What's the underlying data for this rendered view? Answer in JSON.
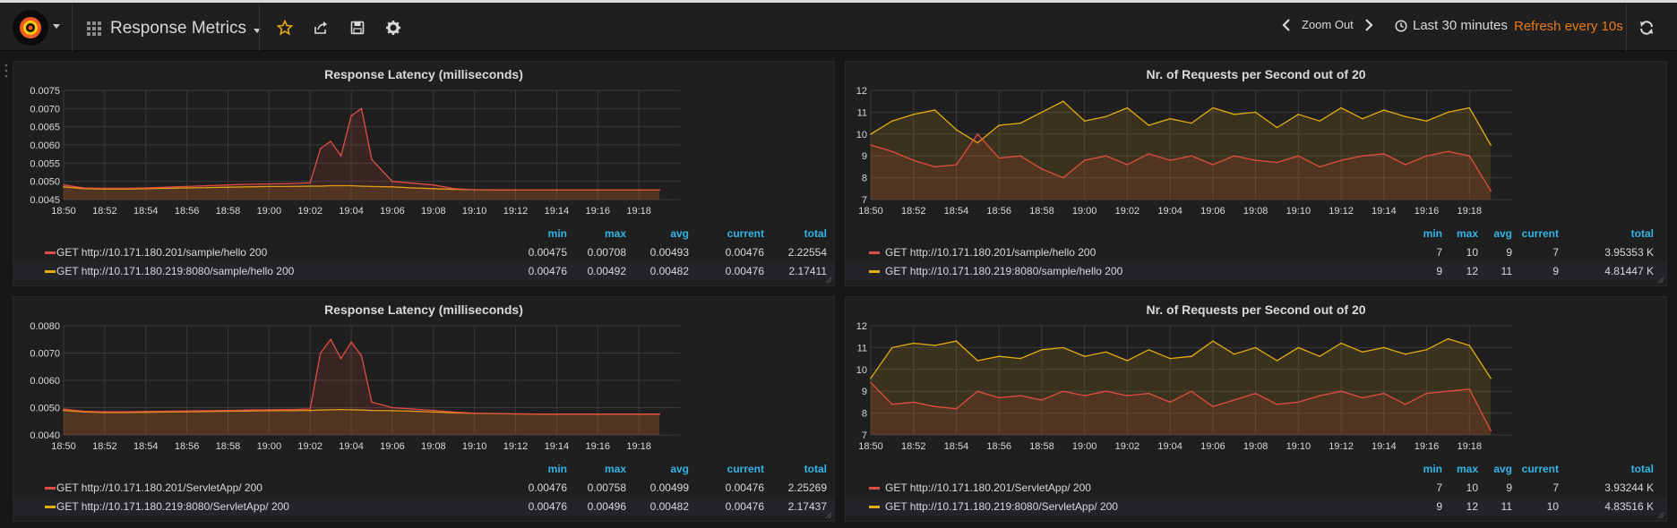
{
  "topbar": {
    "dashboard_title": "Response Metrics",
    "zoom_out_label": "Zoom Out",
    "time_range_label": "Last 30 minutes",
    "refresh_label": "Refresh every 10s"
  },
  "colors": {
    "series_red": "#e24d42",
    "series_yellow": "#e5ac0e",
    "accent_orange": "#eb7b18",
    "legend_header_blue": "#33b5e5"
  },
  "icons": [
    "grafana-logo-icon",
    "dashboard-grid-icon",
    "star-icon",
    "share-icon",
    "save-icon",
    "gear-icon",
    "chevron-left-icon",
    "chevron-right-icon",
    "clock-icon",
    "refresh-icon"
  ],
  "chart_data": [
    {
      "type": "area",
      "title": "Response Latency (milliseconds)",
      "xlabel": "",
      "ylabel": "",
      "x_ticks": [
        "18:50",
        "18:52",
        "18:54",
        "18:56",
        "18:58",
        "19:00",
        "19:02",
        "19:04",
        "19:06",
        "19:08",
        "19:10",
        "19:12",
        "19:14",
        "19:16",
        "19:18"
      ],
      "y_ticks": [
        "0.0045",
        "0.0050",
        "0.0055",
        "0.0060",
        "0.0065",
        "0.0070",
        "0.0075"
      ],
      "ylim": [
        0.0045,
        0.0075
      ],
      "grid": true,
      "x": [
        "18:50",
        "18:51",
        "18:52",
        "18:53",
        "18:54",
        "18:55",
        "18:56",
        "18:57",
        "18:58",
        "18:59",
        "19:00",
        "19:01",
        "19:02",
        "19:02:30",
        "19:03",
        "19:03:30",
        "19:04",
        "19:04:30",
        "19:05",
        "19:06",
        "19:07",
        "19:08",
        "19:09",
        "19:10",
        "19:12",
        "19:14",
        "19:16",
        "19:18",
        "19:19"
      ],
      "series": [
        {
          "name": "GET http://10.171.180.201/sample/hello 200",
          "color": "#e24d42",
          "values": [
            0.0049,
            0.00482,
            0.00481,
            0.00481,
            0.00482,
            0.00484,
            0.00486,
            0.00488,
            0.0049,
            0.00492,
            0.00493,
            0.00494,
            0.00496,
            0.0059,
            0.0061,
            0.0057,
            0.0068,
            0.007,
            0.0056,
            0.005,
            0.00495,
            0.0049,
            0.0048,
            0.00477,
            0.00476,
            0.00476,
            0.00476,
            0.00476,
            0.00476
          ]
        },
        {
          "name": "GET http://10.171.180.219:8080/sample/hello 200",
          "color": "#e5ac0e",
          "values": [
            0.00485,
            0.0048,
            0.00479,
            0.00479,
            0.0048,
            0.00481,
            0.00482,
            0.00483,
            0.00484,
            0.00485,
            0.00486,
            0.00486,
            0.00487,
            0.00487,
            0.00488,
            0.00488,
            0.00488,
            0.00487,
            0.00486,
            0.00485,
            0.00482,
            0.0048,
            0.00478,
            0.00477,
            0.00476,
            0.00476,
            0.00476,
            0.00476,
            0.00476
          ]
        }
      ]
    },
    {
      "type": "area",
      "title": "Nr. of Requests per Second out of 20",
      "xlabel": "",
      "ylabel": "",
      "x_ticks": [
        "18:50",
        "18:52",
        "18:54",
        "18:56",
        "18:58",
        "19:00",
        "19:02",
        "19:04",
        "19:06",
        "19:08",
        "19:10",
        "19:12",
        "19:14",
        "19:16",
        "19:18"
      ],
      "y_ticks": [
        "7",
        "8",
        "9",
        "10",
        "11",
        "12"
      ],
      "ylim": [
        7,
        12
      ],
      "grid": true,
      "x": [
        "18:50",
        "18:51",
        "18:52",
        "18:53",
        "18:54",
        "18:55",
        "18:56",
        "18:57",
        "18:58",
        "18:59",
        "19:00",
        "19:01",
        "19:02",
        "19:03",
        "19:04",
        "19:05",
        "19:06",
        "19:07",
        "19:08",
        "19:09",
        "19:10",
        "19:11",
        "19:12",
        "19:13",
        "19:14",
        "19:15",
        "19:16",
        "19:17",
        "19:18",
        "19:19"
      ],
      "series": [
        {
          "name": "GET http://10.171.180.201/sample/hello 200",
          "color": "#e24d42",
          "values": [
            9.5,
            9.2,
            8.8,
            8.5,
            8.6,
            10.0,
            8.9,
            9.0,
            8.4,
            8.0,
            8.8,
            9.0,
            8.6,
            9.1,
            8.8,
            9.0,
            8.6,
            9.0,
            8.8,
            8.7,
            9.0,
            8.5,
            8.8,
            9.0,
            9.1,
            8.6,
            9.0,
            9.2,
            9.0,
            7.4
          ]
        },
        {
          "name": "GET http://10.171.180.219:8080/sample/hello 200",
          "color": "#e5ac0e",
          "values": [
            10.0,
            10.6,
            10.9,
            11.1,
            10.2,
            9.6,
            10.4,
            10.5,
            11.0,
            11.5,
            10.6,
            10.8,
            11.2,
            10.4,
            10.7,
            10.5,
            11.2,
            10.9,
            11.0,
            10.3,
            10.9,
            10.6,
            11.2,
            10.7,
            11.1,
            10.8,
            10.6,
            11.0,
            11.2,
            9.5
          ]
        }
      ]
    },
    {
      "type": "area",
      "title": "Response Latency (milliseconds)",
      "xlabel": "",
      "ylabel": "",
      "x_ticks": [
        "18:50",
        "18:52",
        "18:54",
        "18:56",
        "18:58",
        "19:00",
        "19:02",
        "19:04",
        "19:06",
        "19:08",
        "19:10",
        "19:12",
        "19:14",
        "19:16",
        "19:18"
      ],
      "y_ticks": [
        "0.0040",
        "0.0050",
        "0.0060",
        "0.0070",
        "0.0080"
      ],
      "ylim": [
        0.004,
        0.008
      ],
      "grid": true,
      "x": [
        "18:50",
        "18:51",
        "18:52",
        "18:53",
        "18:54",
        "18:55",
        "18:56",
        "18:57",
        "18:58",
        "18:59",
        "19:00",
        "19:01",
        "19:02",
        "19:02:30",
        "19:03",
        "19:03:30",
        "19:04",
        "19:04:30",
        "19:05",
        "19:06",
        "19:07",
        "19:08",
        "19:09",
        "19:10",
        "19:12",
        "19:14",
        "19:16",
        "19:18",
        "19:19"
      ],
      "series": [
        {
          "name": "GET http://10.171.180.201/ServletApp/ 200",
          "color": "#e24d42",
          "values": [
            0.00495,
            0.00487,
            0.00485,
            0.00485,
            0.00486,
            0.00487,
            0.00488,
            0.00489,
            0.0049,
            0.00491,
            0.00492,
            0.00493,
            0.00495,
            0.007,
            0.0075,
            0.0068,
            0.0074,
            0.0069,
            0.0052,
            0.005,
            0.00495,
            0.0049,
            0.00484,
            0.0048,
            0.00477,
            0.00476,
            0.00476,
            0.00476,
            0.00476
          ]
        },
        {
          "name": "GET http://10.171.180.219:8080/ServletApp/ 200",
          "color": "#e5ac0e",
          "values": [
            0.0049,
            0.00484,
            0.00482,
            0.00482,
            0.00483,
            0.00484,
            0.00485,
            0.00486,
            0.00487,
            0.00488,
            0.00489,
            0.00489,
            0.0049,
            0.00491,
            0.00492,
            0.00493,
            0.00492,
            0.00491,
            0.0049,
            0.00489,
            0.00487,
            0.00484,
            0.00481,
            0.00479,
            0.00477,
            0.00476,
            0.00476,
            0.00476,
            0.00476
          ]
        }
      ]
    },
    {
      "type": "area",
      "title": "Nr. of Requests per Second out of 20",
      "xlabel": "",
      "ylabel": "",
      "x_ticks": [
        "18:50",
        "18:52",
        "18:54",
        "18:56",
        "18:58",
        "19:00",
        "19:02",
        "19:04",
        "19:06",
        "19:08",
        "19:10",
        "19:12",
        "19:14",
        "19:16",
        "19:18"
      ],
      "y_ticks": [
        "7",
        "8",
        "9",
        "10",
        "11",
        "12"
      ],
      "ylim": [
        7,
        12
      ],
      "grid": true,
      "x": [
        "18:50",
        "18:51",
        "18:52",
        "18:53",
        "18:54",
        "18:55",
        "18:56",
        "18:57",
        "18:58",
        "18:59",
        "19:00",
        "19:01",
        "19:02",
        "19:03",
        "19:04",
        "19:05",
        "19:06",
        "19:07",
        "19:08",
        "19:09",
        "19:10",
        "19:11",
        "19:12",
        "19:13",
        "19:14",
        "19:15",
        "19:16",
        "19:17",
        "19:18",
        "19:19"
      ],
      "series": [
        {
          "name": "GET http://10.171.180.201/ServletApp/ 200",
          "color": "#e24d42",
          "values": [
            9.4,
            8.4,
            8.5,
            8.3,
            8.2,
            9.0,
            8.7,
            8.8,
            8.6,
            9.0,
            8.8,
            9.0,
            8.8,
            8.9,
            8.5,
            9.0,
            8.3,
            8.6,
            8.9,
            8.4,
            8.5,
            8.8,
            9.0,
            8.7,
            8.9,
            8.4,
            8.9,
            9.0,
            9.1,
            7.2
          ]
        },
        {
          "name": "GET http://10.171.180.219:8080/ServletApp/ 200",
          "color": "#e5ac0e",
          "values": [
            9.6,
            11.0,
            11.2,
            11.1,
            11.3,
            10.4,
            10.6,
            10.5,
            10.9,
            11.0,
            10.6,
            10.8,
            10.4,
            10.9,
            10.5,
            10.6,
            11.3,
            10.7,
            11.0,
            10.4,
            11.0,
            10.6,
            11.2,
            10.8,
            11.0,
            10.7,
            10.9,
            11.4,
            11.1,
            9.6
          ]
        }
      ]
    }
  ],
  "legends": [
    {
      "headers": [
        "min",
        "max",
        "avg",
        "current",
        "total"
      ],
      "rows": [
        {
          "name": "GET http://10.171.180.201/sample/hello 200",
          "min": "0.00475",
          "max": "0.00708",
          "avg": "0.00493",
          "current": "0.00476",
          "total": "2.22554"
        },
        {
          "name": "GET http://10.171.180.219:8080/sample/hello 200",
          "min": "0.00476",
          "max": "0.00492",
          "avg": "0.00482",
          "current": "0.00476",
          "total": "2.17411"
        }
      ]
    },
    {
      "headers": [
        "min",
        "max",
        "avg",
        "current",
        "total"
      ],
      "rows": [
        {
          "name": "GET http://10.171.180.201/sample/hello 200",
          "min": "7",
          "max": "10",
          "avg": "9",
          "current": "7",
          "total": "3.95353 K"
        },
        {
          "name": "GET http://10.171.180.219:8080/sample/hello 200",
          "min": "9",
          "max": "12",
          "avg": "11",
          "current": "9",
          "total": "4.81447 K"
        }
      ]
    },
    {
      "headers": [
        "min",
        "max",
        "avg",
        "current",
        "total"
      ],
      "rows": [
        {
          "name": "GET http://10.171.180.201/ServletApp/ 200",
          "min": "0.00476",
          "max": "0.00758",
          "avg": "0.00499",
          "current": "0.00476",
          "total": "2.25269"
        },
        {
          "name": "GET http://10.171.180.219:8080/ServletApp/ 200",
          "min": "0.00476",
          "max": "0.00496",
          "avg": "0.00482",
          "current": "0.00476",
          "total": "2.17437"
        }
      ]
    },
    {
      "headers": [
        "min",
        "max",
        "avg",
        "current",
        "total"
      ],
      "rows": [
        {
          "name": "GET http://10.171.180.201/ServletApp/ 200",
          "min": "7",
          "max": "10",
          "avg": "9",
          "current": "7",
          "total": "3.93244 K"
        },
        {
          "name": "GET http://10.171.180.219:8080/ServletApp/ 200",
          "min": "9",
          "max": "12",
          "avg": "11",
          "current": "10",
          "total": "4.83516 K"
        }
      ]
    }
  ]
}
